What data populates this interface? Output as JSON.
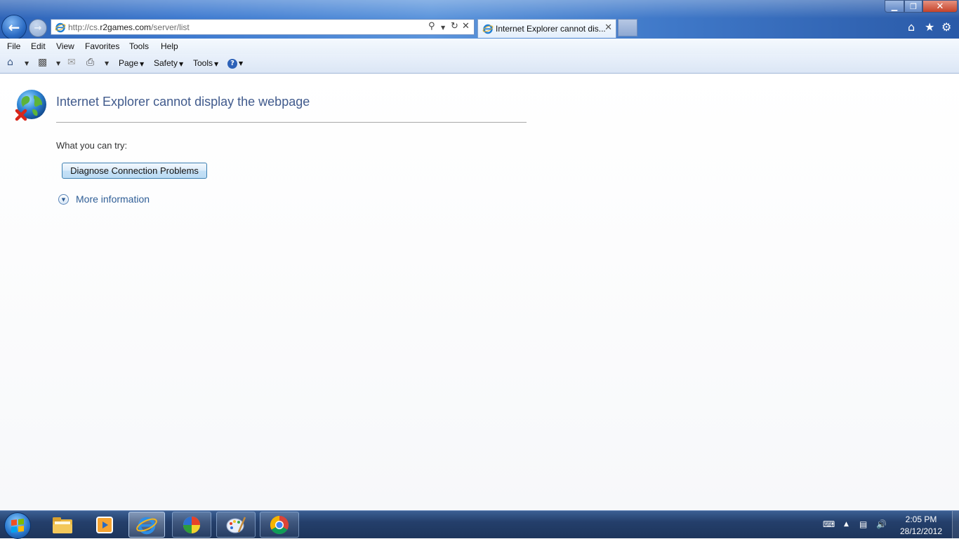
{
  "browser": {
    "address_url_prefix": "http://cs.",
    "address_url_domain": "r2games.com",
    "address_url_path": "/server/list",
    "tab_title": "Internet Explorer cannot dis..."
  },
  "menu": [
    "File",
    "Edit",
    "View",
    "Favorites",
    "Tools",
    "Help"
  ],
  "commandbar": {
    "page_label": "Page",
    "safety_label": "Safety",
    "tools_label": "Tools"
  },
  "error_page": {
    "title": "Internet Explorer cannot display the webpage",
    "try_label": "What you can try:",
    "diagnose_button": "Diagnose Connection Problems",
    "more_info_link": "More information"
  },
  "taskbar": {
    "apps": [
      "file-explorer",
      "media-player",
      "internet-explorer",
      "color-app",
      "paint-app",
      "chrome"
    ],
    "active_app": "internet-explorer"
  },
  "clock": {
    "time": "2:05 PM",
    "date": "28/12/2012"
  },
  "colors": {
    "title_blue": "#405a8c",
    "link_blue": "#2e5d96",
    "taskbar": "#243f6b"
  }
}
